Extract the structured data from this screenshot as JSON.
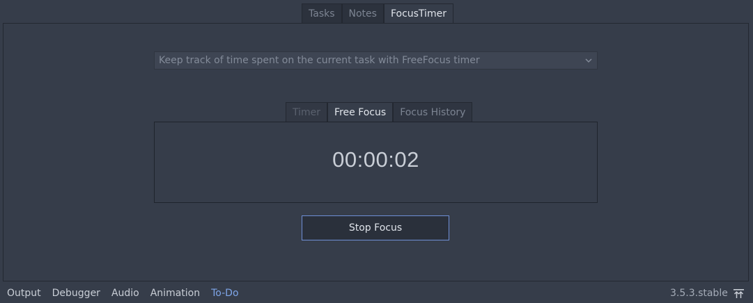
{
  "top_tabs": [
    {
      "label": "Tasks"
    },
    {
      "label": "Notes"
    },
    {
      "label": "FocusTimer"
    }
  ],
  "description_select": {
    "selected": "Keep track of time spent on the current task with FreeFocus timer",
    "icon": "chevron-down-icon"
  },
  "inner_tabs": [
    {
      "label": "Timer"
    },
    {
      "label": "Free Focus"
    },
    {
      "label": "Focus History"
    }
  ],
  "timer": {
    "display": "00:00:02"
  },
  "stop_button": {
    "label": "Stop Focus"
  },
  "bottom_bar": {
    "items": [
      {
        "label": "Output"
      },
      {
        "label": "Debugger"
      },
      {
        "label": "Audio"
      },
      {
        "label": "Animation"
      },
      {
        "label": "To-Do"
      }
    ],
    "version": "3.5.3.stable",
    "expand_icon": "expand-panel-icon"
  },
  "colors": {
    "background": "#363d4a",
    "accent": "#6f8fd6",
    "active_bottom_item": "#7ea5e8"
  }
}
